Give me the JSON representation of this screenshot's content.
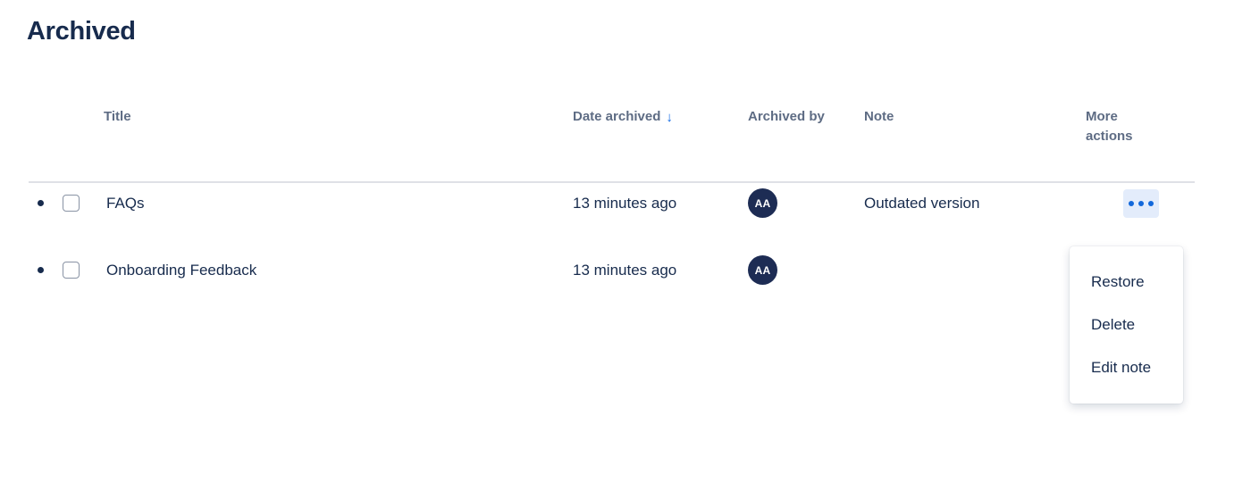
{
  "page": {
    "title": "Archived"
  },
  "table": {
    "columns": [
      {
        "key": "bullet",
        "label": ""
      },
      {
        "key": "select",
        "label": ""
      },
      {
        "key": "title",
        "label": "Title"
      },
      {
        "key": "date_archived",
        "label": "Date archived",
        "sorted": true,
        "sort_direction": "desc",
        "sort_glyph": "↓",
        "color": "#0c66e4"
      },
      {
        "key": "archived_by",
        "label": "Archived by"
      },
      {
        "key": "note",
        "label": "Note"
      },
      {
        "key": "more_actions",
        "label": "More actions"
      }
    ],
    "rows": [
      {
        "title": "FAQs",
        "date_archived": "13 minutes ago",
        "archived_by_initials": "AA",
        "note": "Outdated version",
        "checked": false,
        "menu_open": true
      },
      {
        "title": "Onboarding Feedback",
        "date_archived": "13 minutes ago",
        "archived_by_initials": "AA",
        "note": "",
        "checked": false,
        "menu_open": false
      }
    ]
  },
  "dropdown": {
    "items": [
      {
        "label": "Restore"
      },
      {
        "label": "Delete"
      },
      {
        "label": "Edit note"
      }
    ]
  },
  "colors": {
    "title_text": "#172b4d",
    "header_text": "#5e6c84",
    "accent_blue": "#0c66e4",
    "avatar_bg": "#1d2c54",
    "more_btn_bg": "#e3ecfb",
    "divider": "#dfe1e6"
  }
}
